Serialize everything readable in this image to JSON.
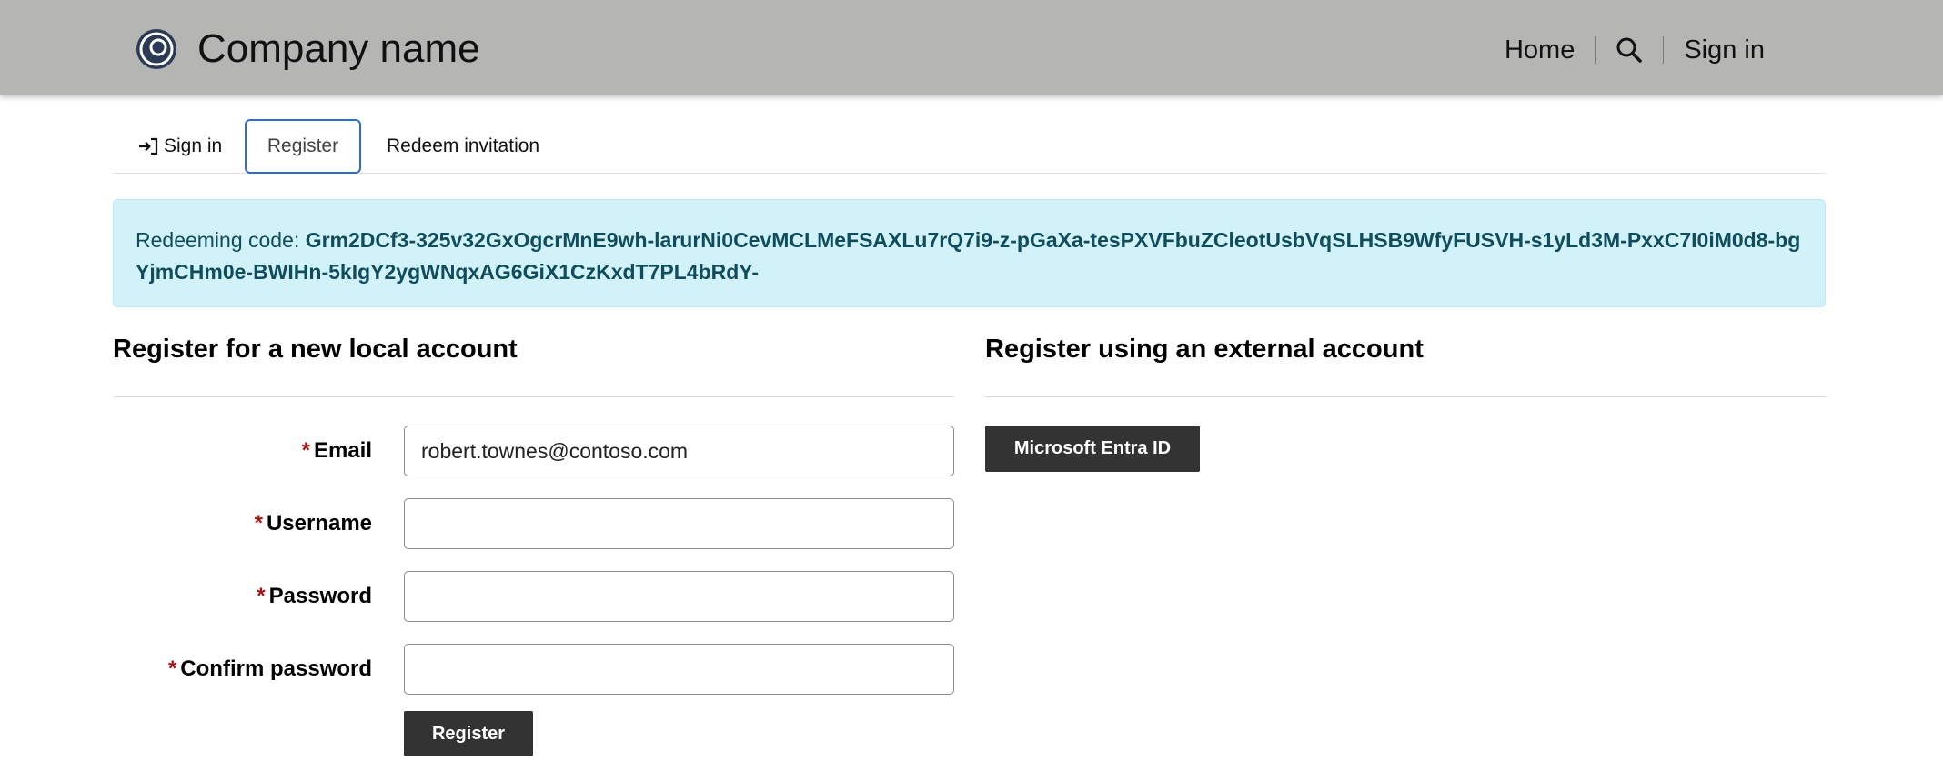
{
  "header": {
    "brand_name": "Company name",
    "nav": {
      "home": "Home",
      "search_icon": "search-icon",
      "sign_in": "Sign in"
    }
  },
  "tabs": {
    "sign_in": "Sign in",
    "register": "Register",
    "redeem": "Redeem invitation",
    "active": "Register"
  },
  "alert": {
    "label": "Redeeming code: ",
    "code": "Grm2DCf3-325v32GxOgcrMnE9wh-larurNi0CevMCLMeFSAXLu7rQ7i9-z-pGaXa-tesPXVFbuZCleotUsbVqSLHSB9WfyFUSVH-s1yLd3M-PxxC7I0iM0d8-bgYjmCHm0e-BWIHn-5kIgY2ygWNqxAG6GiX1CzKxdT7PL4bRdY-"
  },
  "local_account": {
    "title": "Register for a new local account",
    "required_marker": "*",
    "fields": {
      "email": {
        "label": "Email",
        "value": "robert.townes@contoso.com"
      },
      "username": {
        "label": "Username",
        "value": ""
      },
      "password": {
        "label": "Password",
        "value": ""
      },
      "confirm_password": {
        "label": "Confirm password",
        "value": ""
      }
    },
    "submit_label": "Register"
  },
  "external_account": {
    "title": "Register using an external account",
    "providers": [
      "Microsoft Entra ID"
    ]
  },
  "colors": {
    "header_bg": "#b5b5b4",
    "alert_bg": "#d1f2f8",
    "alert_text": "#0f4c5c",
    "button_bg": "#333333",
    "tab_focus": "#2f6bd5",
    "required": "#a31515"
  }
}
